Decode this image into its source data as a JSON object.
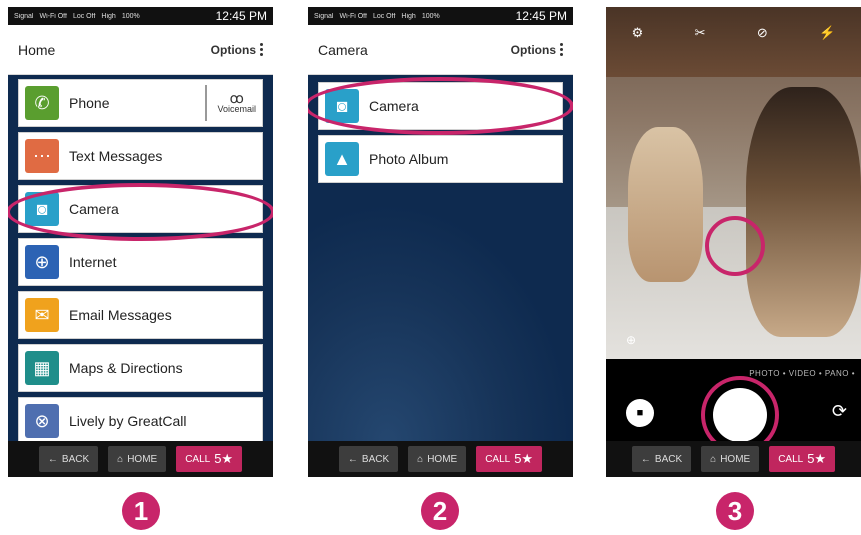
{
  "status": {
    "signal": "Signal",
    "wifi": "Wi-Fi Off",
    "location": "Loc Off",
    "high": "High",
    "battery": "100%",
    "time": "12:45 PM"
  },
  "options_label": "Options",
  "nav": {
    "back": "BACK",
    "home": "HOME",
    "call": "CALL",
    "five_star": "5★"
  },
  "screen1": {
    "title": "Home",
    "items": [
      {
        "label": "Phone",
        "icon": "phone-icon",
        "color": "#5a9e2f",
        "glyph": "📞",
        "secondary": "Voicemail",
        "secondary_icon": "ꝏ"
      },
      {
        "label": "Text Messages",
        "icon": "chat-icon",
        "color": "#e06b43",
        "glyph": "💬"
      },
      {
        "label": "Camera",
        "icon": "camera-icon",
        "color": "#29a0c9",
        "glyph": "◙"
      },
      {
        "label": "Internet",
        "icon": "globe-icon",
        "color": "#2c63b4",
        "glyph": "🌐"
      },
      {
        "label": "Email Messages",
        "icon": "mail-icon",
        "color": "#f0a21d",
        "glyph": "✉"
      },
      {
        "label": "Maps & Directions",
        "icon": "map-icon",
        "color": "#1f8e8a",
        "glyph": "▦"
      },
      {
        "label": "Lively by GreatCall",
        "icon": "lively-icon",
        "color": "#4f6fb0",
        "glyph": "⊗"
      }
    ]
  },
  "screen2": {
    "title": "Camera",
    "items": [
      {
        "label": "Camera",
        "icon": "camera-icon",
        "color": "#29a0c9",
        "glyph": "◙"
      },
      {
        "label": "Photo Album",
        "icon": "photo-album-icon",
        "color": "#29a0c9",
        "glyph": "▲"
      }
    ]
  },
  "screen3": {
    "modes": "PHOTO • VIDEO • PANO •",
    "tools": [
      "⚙",
      "✂",
      "⊘",
      "⚡"
    ]
  },
  "steps": [
    "1",
    "2",
    "3"
  ]
}
